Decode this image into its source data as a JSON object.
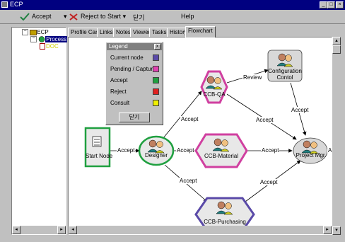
{
  "window": {
    "title": "ECP",
    "btn_min": "_",
    "btn_max": "□",
    "btn_close": "×"
  },
  "menu": {
    "accept": "Accept",
    "reject": "Reject to Start",
    "close": "닫기",
    "help": "Help"
  },
  "tree": {
    "root": "ECP",
    "child": "Process",
    "grandchild": "DOC"
  },
  "tabs": [
    "Profile Card",
    "Links",
    "Notes",
    "Viewer",
    "Tasks",
    "History",
    "Flowchart"
  ],
  "active_tab": "Flowchart",
  "legend": {
    "title": "Legend",
    "close": "x",
    "items": [
      {
        "label": "Current node",
        "color": "#5a4aa8"
      },
      {
        "label": "Pending / Capture",
        "color": "#e040b0"
      },
      {
        "label": "Accept",
        "color": "#20a040"
      },
      {
        "label": "Reject",
        "color": "#e02020"
      },
      {
        "label": "Consult",
        "color": "#f0f000"
      }
    ],
    "button": "닫기"
  },
  "nodes": {
    "start": "Start Node",
    "designer": "Designer",
    "ccbqa": "CCB-QA",
    "config_line1": "Configuration",
    "config_line2": "Contol",
    "ccbmat": "CCB-Material",
    "ccbpur": "CCB-Purchasing",
    "pm": "Project Mgr."
  },
  "edges": {
    "start_designer": "Accept",
    "designer_qa": "Accept",
    "designer_mat": "Accept",
    "designer_pur": "Accept",
    "qa_config": "Review",
    "qa_pm": "Accept",
    "config_pm": "Accept",
    "mat_pm": "Accept",
    "pur_pm": "Accept",
    "pm_right": "A"
  },
  "colors": {
    "accent_green": "#20a040",
    "pending": "#e040b0",
    "current": "#5a4aa8",
    "titlebar": "#000080"
  }
}
